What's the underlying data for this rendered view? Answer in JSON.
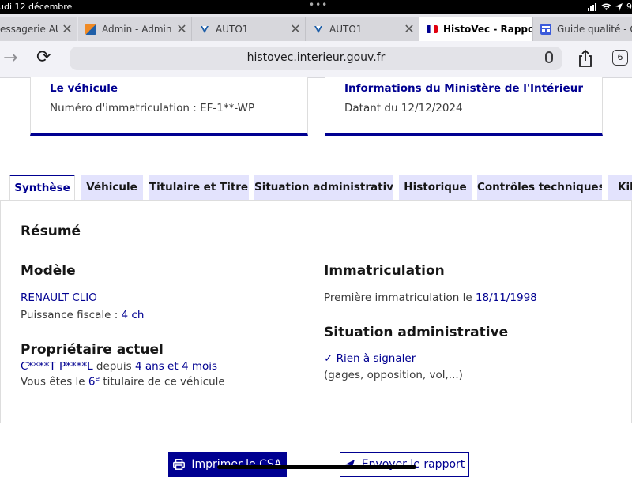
{
  "status_bar": {
    "time": "udi 12 décembre",
    "dots": "•••",
    "battery": "9"
  },
  "browser_tabs": [
    {
      "title": "essagerie AUT",
      "favicon": "mail-icon"
    },
    {
      "title": "Admin - Admin C",
      "favicon": "admin-icon"
    },
    {
      "title": "AUTO1",
      "favicon": "auto1-icon"
    },
    {
      "title": "AUTO1",
      "favicon": "auto1-icon"
    },
    {
      "title": "HistoVec - Rappo",
      "favicon": "france-flag-icon"
    },
    {
      "title": "Guide qualité - G",
      "favicon": "document-icon"
    }
  ],
  "address_bar": {
    "url": "histovec.interieur.gouv.fr",
    "tab_count": "6"
  },
  "cards": {
    "vehicle": {
      "title": "Le véhicule",
      "value": "Numéro d'immatriculation : EF-1**-WP"
    },
    "ministry": {
      "title": "Informations du Ministère de l'Intérieur",
      "value": "Datant du 12/12/2024"
    }
  },
  "page_tabs": [
    "Synthèse",
    "Véhicule",
    "Titulaire et Titre",
    "Situation administrative",
    "Historique",
    "Contrôles techniques",
    "Kilo"
  ],
  "summary": {
    "title": "Résumé",
    "model_heading": "Modèle",
    "model_value": "RENAULT CLIO",
    "fiscal_power_label": "Puissance fiscale : ",
    "fiscal_power_value": "4 ch",
    "owner_heading": "Propriétaire actuel",
    "owner_name": "C****T P****L",
    "owner_since_label": " depuis ",
    "owner_since_value": "4 ans et 4 mois",
    "holder_prefix": "Vous êtes le ",
    "holder_rank": "6",
    "holder_rank_suffix": "e",
    "holder_suffix": " titulaire de ce véhicule",
    "registration_heading": "Immatriculation",
    "first_registration_label": "Première immatriculation le ",
    "first_registration_date": "18/11/1998",
    "admin_heading": "Situation administrative",
    "admin_status": "Rien à signaler",
    "admin_detail": "(gages, opposition, vol,...)"
  },
  "actions": {
    "print": "Imprimer le CSA",
    "send": "Envoyer le rapport"
  },
  "colors": {
    "accent": "#000091",
    "tab_inactive": "#e3e3fd"
  }
}
